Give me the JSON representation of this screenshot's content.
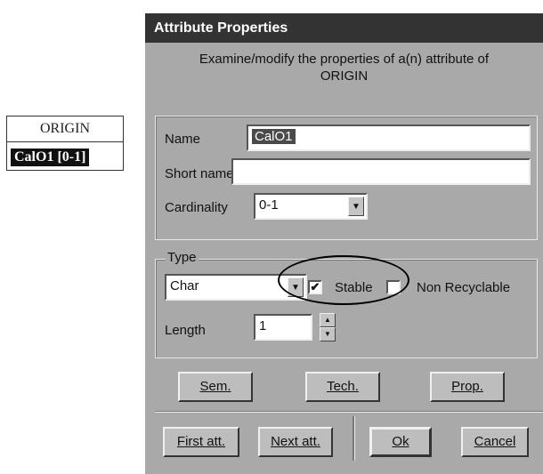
{
  "entity": {
    "title": "ORIGIN",
    "attribute": "CalO1 [0-1]"
  },
  "dialog": {
    "title": "Attribute Properties",
    "description_line1": "Examine/modify the properties of a(n) attribute of",
    "description_line2": "ORIGIN",
    "name_label": "Name",
    "name_value": "CalO1",
    "short_name_label": "Short name",
    "short_name_value": "",
    "cardinality_label": "Cardinality",
    "cardinality_value": "0-1",
    "type_group": {
      "legend": "Type",
      "type_value": "Char",
      "stable_label": "Stable",
      "stable_checked": true,
      "stable_mark": "✔",
      "non_recyclable_label": "Non Recyclable",
      "non_recyclable_checked": false,
      "length_label": "Length",
      "length_value": "1"
    },
    "buttons": {
      "sem": "Sem.",
      "tech": "Tech.",
      "prop": "Prop.",
      "first_att": "First att.",
      "next_att": "Next att.",
      "ok": "Ok",
      "cancel": "Cancel"
    }
  },
  "icons": {
    "combo_arrow": "▼",
    "spin_up": "▲",
    "spin_down": "▼"
  }
}
